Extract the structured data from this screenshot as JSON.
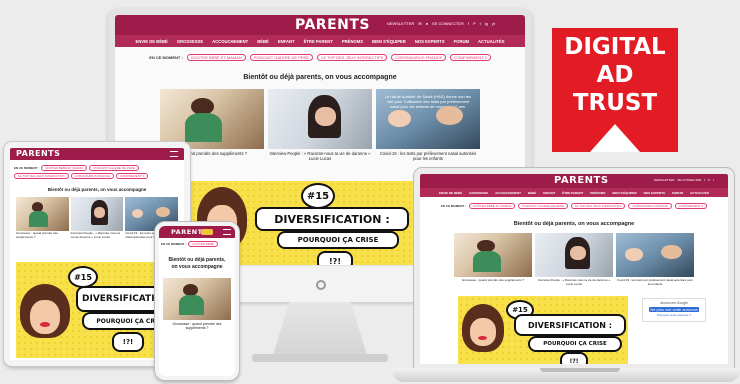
{
  "brand": "PARENTS",
  "header_links": [
    "NEWSLETTER",
    "SE CONNECTER",
    "f",
    "P",
    "t",
    "ig",
    "yt"
  ],
  "nav_items": [
    "ENVIE DE BÉBÉ",
    "GROSSESSE",
    "ACCOUCHEMENT",
    "BÉBÉ",
    "ENFANT",
    "ÊTRE PARENT",
    "PRÉNOMS",
    "BIEN S'ÉQUIPER",
    "NOS EXPERTS",
    "FORUM",
    "ACTUALITÉS"
  ],
  "en_ce_moment_label": "EN CE MOMENT :",
  "tags": [
    "GOÛTER BÉBÉ ET MAMAN",
    "PODCAST GALERE DE PERE",
    "LE TOP DES JEUX INTERACTIFS",
    "CORONAVIRUS FRANCE",
    "CONFINEMENT 3"
  ],
  "headline": "Bientôt ou déjà parents, on vous accompagne",
  "articles": [
    {
      "caption": "Grossesse : quand prendre des suppléments ?"
    },
    {
      "caption": "Interview People : « Raconte-nous ta vie de daronne » Lucie Lucas"
    },
    {
      "caption": "Covid-19 : les tests par prélèvement nasal autorisés pour les enfants",
      "overlay": "La Haute Autorité de Santé (HAS) donne son feu vert pour l'utilisation des tests par prélèvement nasal pour les enfants de moins de 12 ans."
    }
  ],
  "comic": {
    "number": "#15",
    "title": "DIVERSIFICATION :",
    "subtitle": "POURQUOI ÇA CRISE",
    "exclaim": "!?!"
  },
  "ad": {
    "label": "Annonces Google",
    "button": "Ne plus voir cette annonce",
    "link": "Pourquoi cette annonce ?"
  },
  "badge": {
    "line1": "DIGITAL",
    "line2": "AD",
    "line3": "TRUST"
  },
  "phone_tag": "GOÛTER BÉBÉ"
}
